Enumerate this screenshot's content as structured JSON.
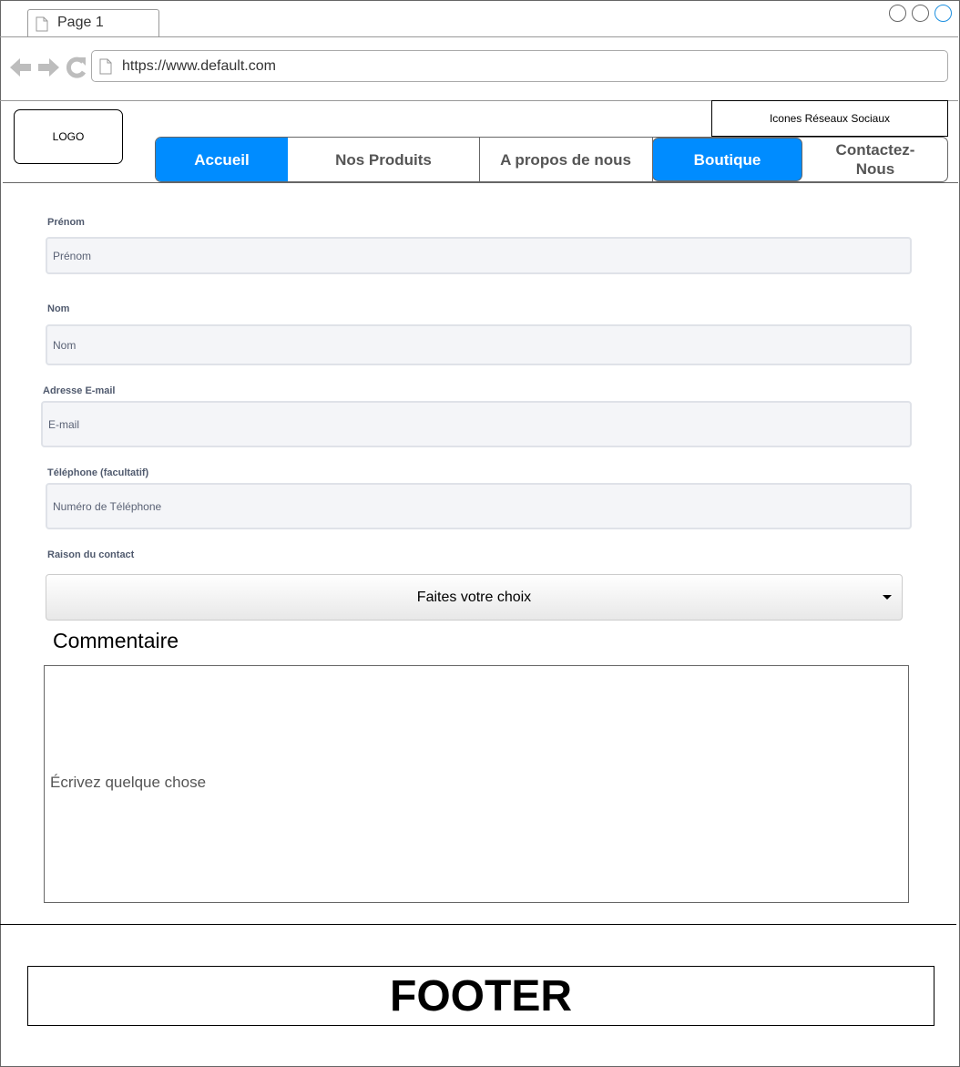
{
  "browser": {
    "tab_title": "Page 1",
    "url": "https://www.default.com",
    "accent_color": "#008cff"
  },
  "header": {
    "logo_text": "LOGO",
    "social_text": "Icones Réseaux Sociaux",
    "menu": [
      {
        "label": "Accueil",
        "active": true
      },
      {
        "label": "Nos Produits",
        "active": false
      },
      {
        "label": "A propos de nous",
        "active": false
      },
      {
        "label": "Boutique",
        "active": true
      },
      {
        "label": "Contactez-Nous",
        "active": false
      }
    ]
  },
  "form": {
    "prenom": {
      "label": "Prénom",
      "placeholder": "Prénom"
    },
    "nom": {
      "label": "Nom",
      "placeholder": "Nom"
    },
    "email": {
      "label": "Adresse E-mail",
      "placeholder": "E-mail"
    },
    "telephone": {
      "label": "Téléphone (facultatif)",
      "placeholder": "Numéro de Téléphone"
    },
    "raison": {
      "label": "Raison du contact",
      "selected": "Faites votre choix"
    },
    "commentaire": {
      "title": "Commentaire",
      "placeholder": "Écrivez quelque chose"
    }
  },
  "footer": {
    "text": "FOOTER"
  }
}
